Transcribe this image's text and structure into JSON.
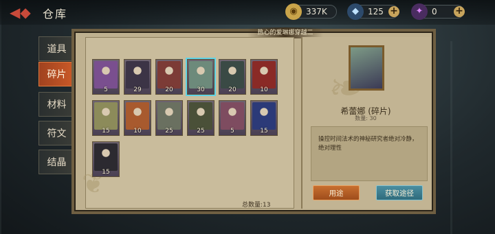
{
  "header": {
    "title": "仓库"
  },
  "resources": [
    {
      "icon": "coin-icon",
      "value": "337K"
    },
    {
      "icon": "diamond-icon",
      "value": "125"
    },
    {
      "icon": "purple-crystal-icon",
      "value": "0"
    }
  ],
  "tabs": [
    {
      "label": "道具",
      "active": false
    },
    {
      "label": "碎片",
      "active": true
    },
    {
      "label": "材料",
      "active": false
    },
    {
      "label": "符文",
      "active": false
    },
    {
      "label": "结晶",
      "active": false
    }
  ],
  "banner": "热心的爱琳娜穿越二",
  "items": [
    {
      "count": "5",
      "color": "#7a4f8f",
      "selected": false
    },
    {
      "count": "29",
      "color": "#3c3446",
      "selected": false
    },
    {
      "count": "20",
      "color": "#7c3b36",
      "selected": false
    },
    {
      "count": "30",
      "color": "#6d8a7b",
      "selected": true
    },
    {
      "count": "20",
      "color": "#3a4a45",
      "selected": false
    },
    {
      "count": "10",
      "color": "#8a2a26",
      "selected": false
    },
    {
      "count": "15",
      "color": "#8c8b5a",
      "selected": false
    },
    {
      "count": "10",
      "color": "#a85a2e",
      "selected": false
    },
    {
      "count": "25",
      "color": "#6a7060",
      "selected": false
    },
    {
      "count": "25",
      "color": "#4a5038",
      "selected": false
    },
    {
      "count": "5",
      "color": "#7e4c60",
      "selected": false
    },
    {
      "count": "15",
      "color": "#2c3a78",
      "selected": false
    },
    {
      "count": "15",
      "color": "#2c2a30",
      "selected": false
    }
  ],
  "total_label": "总数量:13",
  "detail": {
    "name": "希蕾娜 (碎片)",
    "count_label": "数量: 30",
    "description": "操控时间法术的神秘研究者绝对冷静，绝对理性",
    "use_button": "用途",
    "get_button": "获取途径"
  }
}
